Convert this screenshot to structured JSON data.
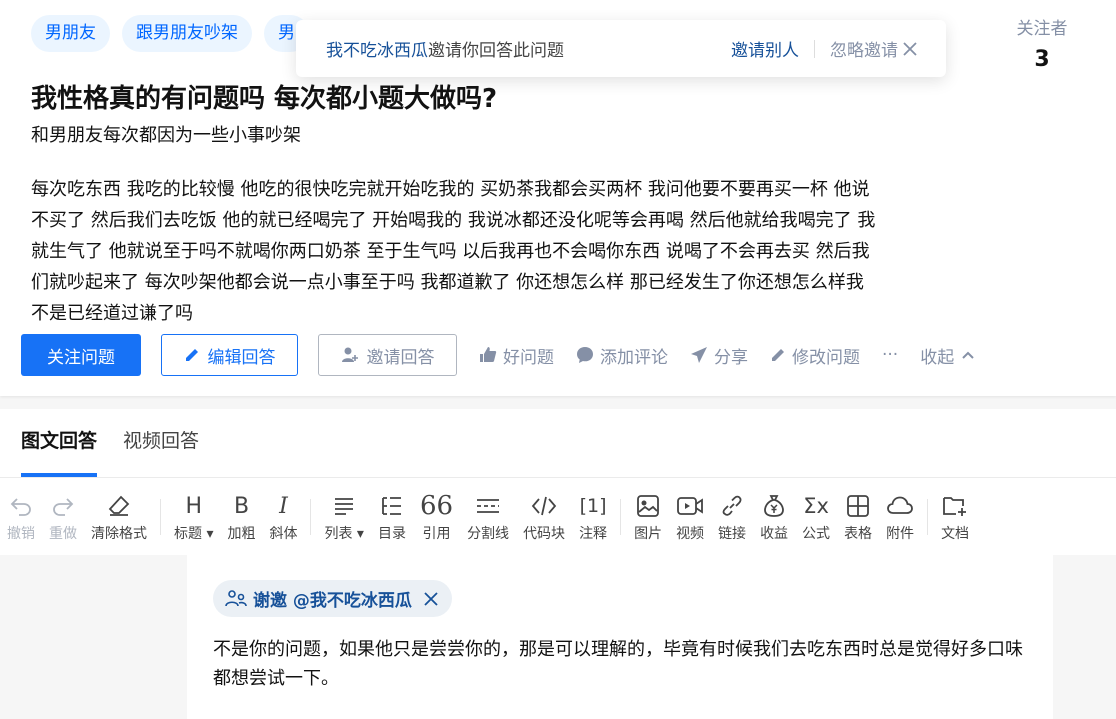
{
  "topics": [
    "男朋友",
    "跟男朋友吵架",
    "男"
  ],
  "invite_popup": {
    "inviter": "我不吃冰西瓜",
    "message": "邀请你回答此问题",
    "invite_others": "邀请别人",
    "ignore": "忽略邀请"
  },
  "followers": {
    "label": "关注者",
    "count": "3"
  },
  "question": {
    "title": "我性格真的有问题吗 每次都小题大做吗?",
    "subtitle": "和男朋友每次都因为一些小事吵架",
    "body": "每次吃东西 我吃的比较慢 他吃的很快吃完就开始吃我的 买奶茶我都会买两杯 我问他要不要再买一杯 他说不买了 然后我们去吃饭 他的就已经喝完了 开始喝我的 我说冰都还没化呢等会再喝 然后他就给我喝完了 我就生气了 他就说至于吗不就喝你两口奶茶 至于生气吗 以后我再也不会喝你东西 说喝了不会再去买 然后我们就吵起来了 每次吵架他都会说一点小事至于吗 我都道歉了 你还想怎么样 那已经发生了你还想怎么样我不是已经道过谦了吗"
  },
  "actions": {
    "follow": "关注问题",
    "edit_answer": "编辑回答",
    "invite_answer": "邀请回答",
    "good_question": "好问题",
    "add_comment": "添加评论",
    "share": "分享",
    "edit_question": "修改问题",
    "more": "···",
    "collapse": "收起"
  },
  "tabs": {
    "text_answer": "图文回答",
    "video_answer": "视频回答"
  },
  "toolbar": {
    "undo": "撤销",
    "redo": "重做",
    "clear_format": "清除格式",
    "heading": "标题",
    "bold": "加粗",
    "italic": "斜体",
    "list": "列表",
    "toc": "目录",
    "quote": "引用",
    "divider": "分割线",
    "code_block": "代码块",
    "footnote": "注释",
    "image": "图片",
    "video": "视频",
    "link": "链接",
    "income": "收益",
    "formula": "公式",
    "table": "表格",
    "attachment": "附件",
    "document": "文档"
  },
  "editor": {
    "thanks_tag": "谢邀 @我不吃冰西瓜",
    "answer_text": "不是你的问题，如果他只是尝尝你的，那是可以理解的，毕竟有时候我们去吃东西时总是觉得好多口味都想尝试一下。"
  },
  "colors": {
    "primary": "#1772f6",
    "link": "#175199",
    "muted": "#8590a6",
    "topic_bg": "#ebf5ff"
  }
}
